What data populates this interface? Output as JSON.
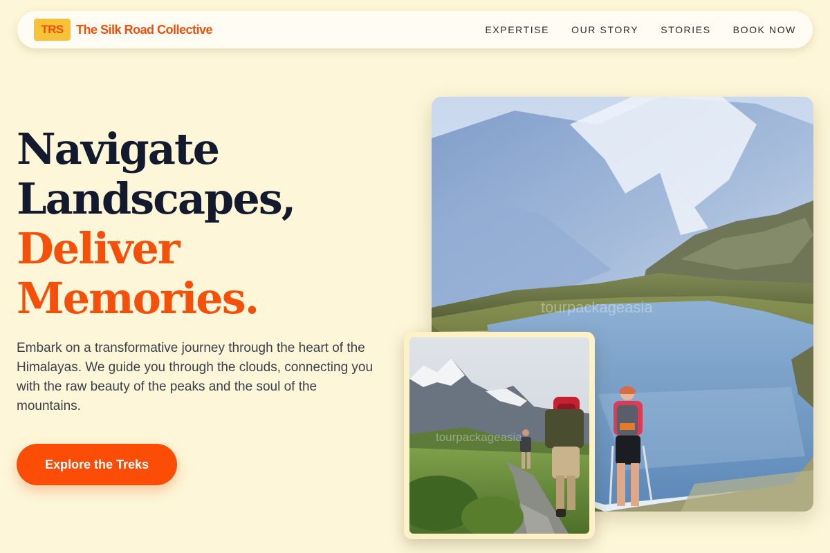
{
  "brand": {
    "logo_text": "TRS",
    "name": "The Silk Road Collective"
  },
  "nav": {
    "links": [
      {
        "label": "EXPERTISE"
      },
      {
        "label": "OUR STORY"
      },
      {
        "label": "STORIES"
      },
      {
        "label": "BOOK NOW"
      }
    ]
  },
  "hero": {
    "headline_line1": "Navigate",
    "headline_line2": "Landscapes,",
    "headline_line3": "Deliver",
    "headline_line4": "Memories.",
    "lead": "Embark on a transformative journey through the heart of the Himalayas. We guide you through the clouds, connecting you with the raw beauty of the peaks and the soul of the mountains.",
    "cta_label": "Explore the Treks"
  },
  "images": {
    "main_watermark": "tourpackageasia",
    "small_watermark": "tourpackageasia"
  },
  "colors": {
    "background": "#fdf6d8",
    "accent": "#f5500a",
    "headline_dark": "#131a2d",
    "logo_bg": "#f6c238"
  }
}
